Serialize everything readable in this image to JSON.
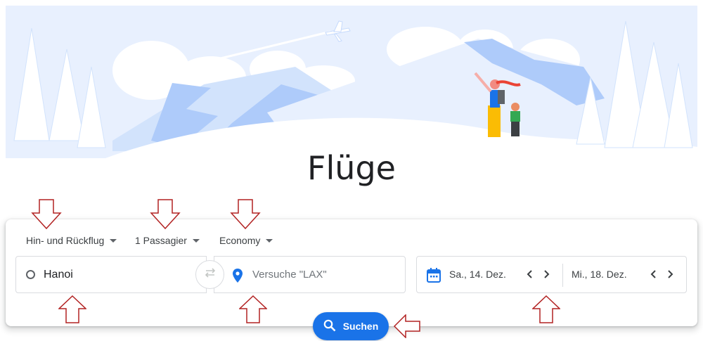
{
  "title": "Flüge",
  "trip_type": {
    "label": "Hin- und Rückflug"
  },
  "passengers": {
    "label": "1 Passagier"
  },
  "cabin_class": {
    "label": "Economy"
  },
  "origin": {
    "value": "Hanoi"
  },
  "destination": {
    "placeholder": "Versuche \"LAX\""
  },
  "dates": {
    "departure": "Sa., 14. Dez.",
    "return": "Mi., 18. Dez."
  },
  "search_button": {
    "label": "Suchen"
  },
  "colors": {
    "accent": "#1a73e8",
    "annotation_arrow": "#b22222",
    "illustration_blue": "#aecbfa"
  },
  "icons": {
    "origin": "origin-circle-icon",
    "destination": "location-pin-icon",
    "swap": "swap-arrows-icon",
    "calendar": "calendar-icon",
    "search": "search-icon"
  }
}
